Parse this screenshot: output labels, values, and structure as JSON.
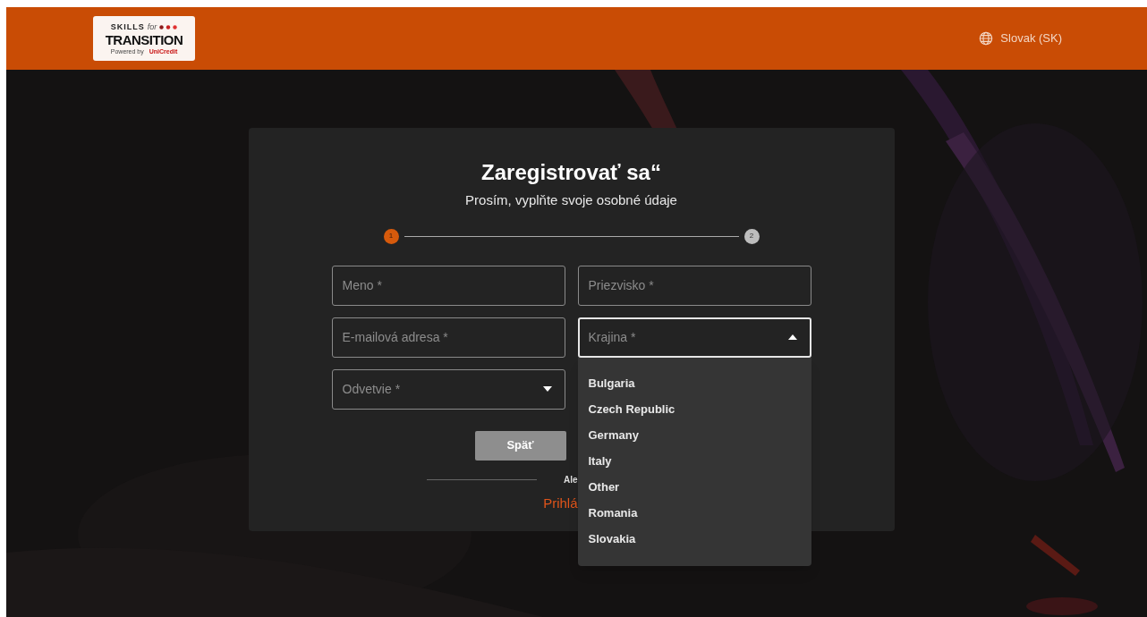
{
  "header": {
    "logo": {
      "skills": "SKILLS",
      "for": "for",
      "title": "TRANSITION",
      "powered_by": "Powered by",
      "partner": "UniCredit"
    },
    "language": "Slovak (SK)"
  },
  "form": {
    "title": "Zaregistrovať sa“",
    "subtitle": "Prosím, vyplňte svoje osobné údaje",
    "steps": [
      {
        "label": "1",
        "selected": true
      },
      {
        "label": "2",
        "selected": false
      }
    ],
    "fields": [
      {
        "kind": "text",
        "placeholder": "Meno *"
      },
      {
        "kind": "text",
        "placeholder": "Priezvisko *"
      },
      {
        "kind": "text",
        "placeholder": "E-mailová adresa *"
      },
      {
        "kind": "select",
        "placeholder": "Krajina *",
        "expanded": true,
        "options": [
          "Bulgaria",
          "Czech Republic",
          "Germany",
          "Italy",
          "Other",
          "Romania",
          "Slovakia"
        ]
      },
      {
        "kind": "select",
        "placeholder": "Odvetvie *",
        "expanded": false
      }
    ],
    "back_button": {
      "label": "Späť",
      "disabled": true
    },
    "divider_text": "Ale",
    "login_link": "Prihlá"
  }
}
